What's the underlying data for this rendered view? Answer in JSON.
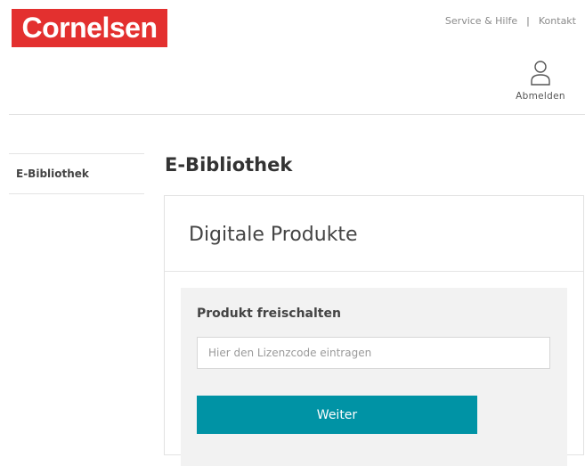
{
  "brand": {
    "logo_text": "Cornelsen",
    "color": "#e3302f"
  },
  "header": {
    "links": [
      "Service & Hilfe",
      "Kontakt"
    ],
    "separator": "|",
    "user": {
      "icon": "user-icon",
      "label": "Abmelden"
    }
  },
  "sidebar": {
    "items": [
      {
        "label": "E-Bibliothek"
      }
    ]
  },
  "main": {
    "page_title": "E-Bibliothek",
    "card": {
      "title": "Digitale Produkte",
      "activation": {
        "title": "Produkt freischalten",
        "input": {
          "placeholder": "Hier den Lizenzcode eintragen",
          "value": ""
        },
        "button_label": "Weiter",
        "button_color": "#0093a5"
      }
    }
  }
}
